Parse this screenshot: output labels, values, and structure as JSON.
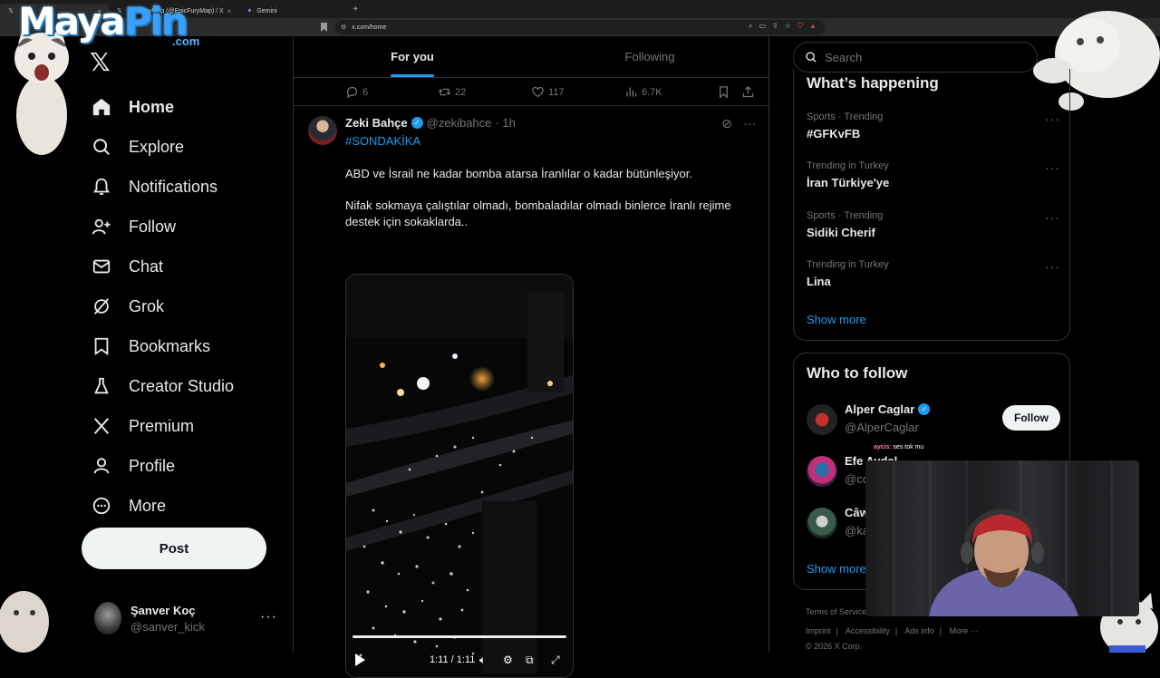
{
  "browser": {
    "tabs": [
      {
        "label": "",
        "active": true
      },
      {
        "label": "EpicFuryMap (@EpicFuryMap) / X",
        "active": false
      },
      {
        "label": "Gemini",
        "active": false
      }
    ],
    "url": "x.com/home"
  },
  "overlay": {
    "logo_word_1": "Maya",
    "logo_word_2": "Pin",
    "logo_suffix": ".com",
    "chat_user": "aycis",
    "chat_message": ": ses tok mu"
  },
  "nav": {
    "items": [
      {
        "label": "Home",
        "icon": "home-icon"
      },
      {
        "label": "Explore",
        "icon": "search-icon"
      },
      {
        "label": "Notifications",
        "icon": "bell-icon"
      },
      {
        "label": "Follow",
        "icon": "follow-icon"
      },
      {
        "label": "Chat",
        "icon": "mail-icon"
      },
      {
        "label": "Grok",
        "icon": "grok-icon"
      },
      {
        "label": "Bookmarks",
        "icon": "bookmark-icon"
      },
      {
        "label": "Creator Studio",
        "icon": "flask-icon"
      },
      {
        "label": "Premium",
        "icon": "x-icon"
      },
      {
        "label": "Profile",
        "icon": "person-icon"
      },
      {
        "label": "More",
        "icon": "more-circle-icon"
      }
    ],
    "post_label": "Post",
    "profile_name": "Şanver Koç",
    "profile_handle": "@sanver_kick"
  },
  "timeline": {
    "tabs": [
      "For you",
      "Following"
    ],
    "prev_actions": {
      "replies": "6",
      "reposts": "22",
      "likes": "117",
      "views": "6.7K"
    },
    "tweet": {
      "name": "Zeki Bahçe",
      "handle": "@zekibahce",
      "time": "· 1h",
      "hashtag": "#SONDAKİKA",
      "text_1": "ABD ve İsrail ne kadar bomba atarsa İranlılar o kadar bütünleşiyor.",
      "text_2": "Nifak sokmaya çalıştılar olmadı, bombaladılar olmadı binlerce İranlı rejime destek için sokaklarda..",
      "video_time": "1:11 / 1:11"
    }
  },
  "sidebar": {
    "search_placeholder": "Search",
    "happening_title": "What’s happening",
    "trends": [
      {
        "context": "Sports · Trending",
        "title": "#GFKvFB"
      },
      {
        "context": "Trending in Turkey",
        "title": "İran Türkiye'ye"
      },
      {
        "context": "Sports · Trending",
        "title": "Sidiki Cherif"
      },
      {
        "context": "Trending in Turkey",
        "title": "Lina"
      }
    ],
    "show_more": "Show more",
    "wtf_title": "Who to follow",
    "follow": [
      {
        "name": "Alper Caglar",
        "handle": "@AlperCaglar",
        "button": "Follow"
      },
      {
        "name": "Efe Aydal",
        "handle": "@co",
        "button": ""
      },
      {
        "name": "Câw",
        "handle": "@ka",
        "button": ""
      }
    ],
    "show_more_2": "Show more",
    "footer_1": [
      "Terms of Service"
    ],
    "footer_2": [
      "Imprint",
      "Accessibility",
      "Ads info",
      "More ···"
    ],
    "copyright": "© 2026 X Corp."
  },
  "colors": {
    "accent": "#1d9bf0",
    "background": "#000000",
    "border": "#2f3336",
    "muted": "#71767b"
  }
}
